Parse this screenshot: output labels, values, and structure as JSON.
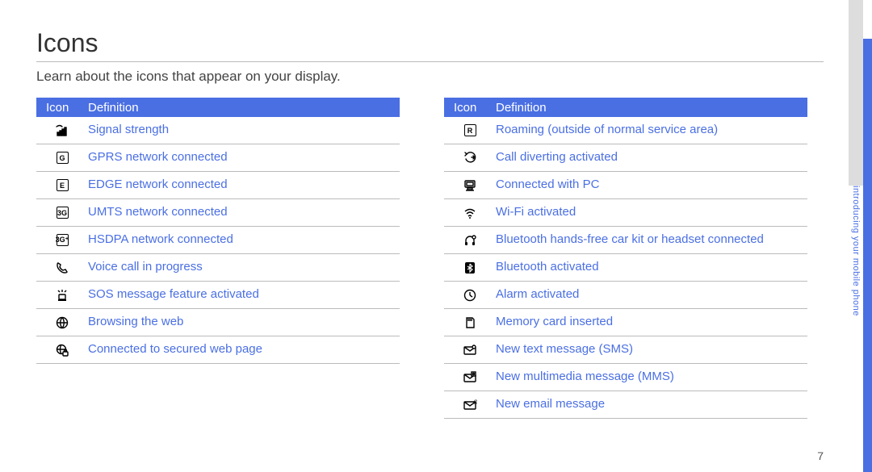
{
  "heading": "Icons",
  "intro": "Learn about the icons that appear on your display.",
  "headers": {
    "icon": "Icon",
    "definition": "Definition"
  },
  "left_rows": [
    {
      "icon": "signal-strength-icon",
      "glyph": "bars",
      "def": "Signal strength"
    },
    {
      "icon": "gprs-icon",
      "glyph": "G",
      "def": "GPRS network connected"
    },
    {
      "icon": "edge-icon",
      "glyph": "E",
      "def": "EDGE network connected"
    },
    {
      "icon": "umts-icon",
      "glyph": "3G",
      "def": "UMTS network connected"
    },
    {
      "icon": "hsdpa-icon",
      "glyph": "3G+",
      "def": "HSDPA network connected"
    },
    {
      "icon": "voice-call-icon",
      "glyph": "phone",
      "def": "Voice call in progress"
    },
    {
      "icon": "sos-icon",
      "glyph": "siren",
      "def": "SOS message feature activated"
    },
    {
      "icon": "browsing-icon",
      "glyph": "globe",
      "def": "Browsing the web"
    },
    {
      "icon": "secured-web-icon",
      "glyph": "globe-lock",
      "def": "Connected to secured web page"
    }
  ],
  "right_rows": [
    {
      "icon": "roaming-icon",
      "glyph": "R",
      "def": "Roaming (outside of normal service area)"
    },
    {
      "icon": "call-divert-icon",
      "glyph": "divert",
      "def": "Call diverting activated"
    },
    {
      "icon": "pc-connect-icon",
      "glyph": "pc",
      "def": "Connected with PC"
    },
    {
      "icon": "wifi-icon",
      "glyph": "wifi",
      "def": "Wi-Fi activated"
    },
    {
      "icon": "bt-headset-icon",
      "glyph": "bt-headset",
      "def": "Bluetooth hands-free car kit or headset connected"
    },
    {
      "icon": "bluetooth-icon",
      "glyph": "bt",
      "def": "Bluetooth activated"
    },
    {
      "icon": "alarm-icon",
      "glyph": "clock",
      "def": "Alarm activated"
    },
    {
      "icon": "memory-card-icon",
      "glyph": "sd",
      "def": "Memory card inserted"
    },
    {
      "icon": "sms-icon",
      "glyph": "sms",
      "def": "New text message (SMS)"
    },
    {
      "icon": "mms-icon",
      "glyph": "mms",
      "def": "New multimedia message (MMS)"
    },
    {
      "icon": "email-icon",
      "glyph": "email",
      "def": "New email message"
    }
  ],
  "side_text": "introducing your mobile phone",
  "page_number": "7"
}
